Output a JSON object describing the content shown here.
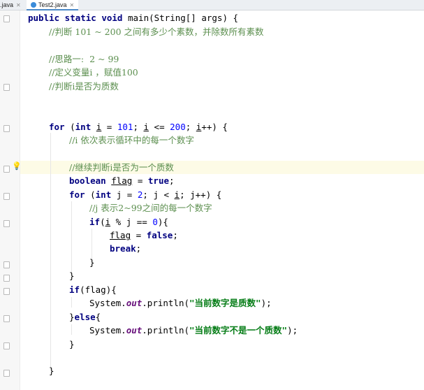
{
  "tabs": [
    {
      "label": ".java",
      "active": false
    },
    {
      "label": "Test2.java",
      "active": true
    }
  ],
  "code": {
    "l1": {
      "k1": "public static void",
      "t1": " main(String[] args) {"
    },
    "l2": {
      "c": "//判断 101 ~ 200 之间有多少个素数，并除数所有素数"
    },
    "l3": {
      "c": "//思路一:  2 ~ 99"
    },
    "l4": {
      "c": "//定义变量i ，赋值100"
    },
    "l5": {
      "c": "//判断i是否为质数"
    },
    "l6": {
      "k1": "for",
      "p1": " (",
      "k2": "int",
      "p2": " ",
      "v1": "i",
      "p3": " = ",
      "n1": "101",
      "p4": "; ",
      "v2": "i",
      "p5": " <= ",
      "n2": "200",
      "p6": "; ",
      "v3": "i",
      "p7": "++) {"
    },
    "l7": {
      "c": "//i 依次表示循环中的每一个数字"
    },
    "l8": {
      "c": "//继续判断i是否为一个质数"
    },
    "l9": {
      "k1": "boolean",
      "p1": " ",
      "v1": "flag",
      "p2": " = ",
      "k2": "true",
      "p3": ";"
    },
    "l10": {
      "k1": "for",
      "p1": " (",
      "k2": "int",
      "p2": " j = ",
      "n1": "2",
      "p3": "; j < ",
      "v1": "i",
      "p4": "; j++) {"
    },
    "l11": {
      "c": "//j 表示2~99之间的每一个数字"
    },
    "l12": {
      "k1": "if",
      "p1": "(",
      "v1": "i",
      "p2": " % j == ",
      "n1": "0",
      "p3": "){"
    },
    "l13": {
      "v1": "flag",
      "p1": " = ",
      "k1": "false",
      "p2": ";"
    },
    "l14": {
      "k1": "break",
      "p1": ";"
    },
    "l15": {
      "t": "}"
    },
    "l16": {
      "t": "}"
    },
    "l17": {
      "k1": "if",
      "p1": "(flag){"
    },
    "l18": {
      "t1": "System.",
      "i1": "out",
      "t2": ".println(",
      "s1": "\"当前数字是质数\"",
      "t3": ");"
    },
    "l19": {
      "p1": "}",
      "k1": "else",
      "p2": "{"
    },
    "l20": {
      "t1": "System.",
      "i1": "out",
      "t2": ".println(",
      "s1": "\"当前数字不是一个质数\"",
      "t3": ");"
    },
    "l21": {
      "t": "}"
    },
    "l22": {
      "t": "}"
    }
  }
}
